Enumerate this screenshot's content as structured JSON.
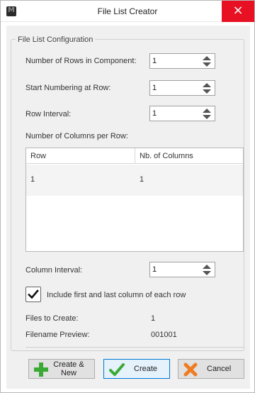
{
  "window": {
    "title": "File List Creator",
    "close_glyph": "×"
  },
  "config": {
    "group_title": "File List Configuration",
    "rows_label": "Number of Rows in Component:",
    "rows_value": "1",
    "start_label": "Start Numbering at Row:",
    "start_value": "1",
    "interval_label": "Row Interval:",
    "interval_value": "1",
    "columns_label": "Number of Columns per Row:",
    "table": {
      "headers": [
        "Row",
        "Nb. of Columns"
      ],
      "rows": [
        [
          "1",
          "1"
        ]
      ]
    },
    "col_interval_label": "Column Interval:",
    "col_interval_value": "1",
    "include_label": "Include first and last column of each row",
    "include_checked": true,
    "files_label": "Files to Create:",
    "files_value": "1",
    "preview_label": "Filename Preview:",
    "preview_value": "001001"
  },
  "buttons": {
    "create_new_line1": "Create &",
    "create_new_line2": "New",
    "create": "Create",
    "cancel": "Cancel"
  },
  "colors": {
    "close": "#e81123",
    "plus": "#3aaa35",
    "check": "#3aaa35",
    "cancel_x": "#f07c22"
  },
  "icons": {
    "app": "app-logo-icon",
    "close": "close-icon",
    "spin": "spin-arrows-icon",
    "check": "checkmark-icon",
    "plus": "plus-icon",
    "cancel": "x-icon"
  }
}
